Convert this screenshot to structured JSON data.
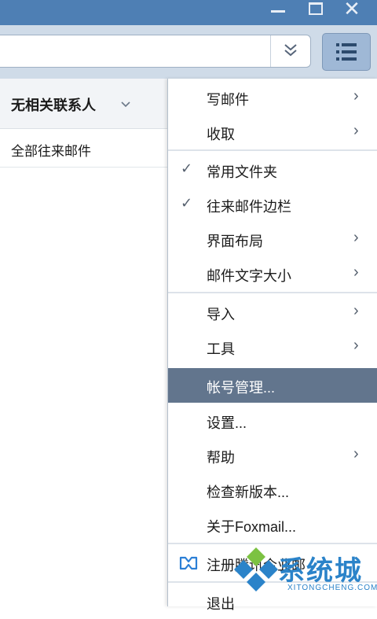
{
  "window": {
    "minimize_icon": "minimize-icon",
    "maximize_icon": "maximize-icon",
    "close_glyph": "✕"
  },
  "toolbar": {
    "search_dropdown_glyph": "»",
    "menu_icon": "hamburger-list-icon"
  },
  "left_pane": {
    "header_title": "无相关联系人",
    "header_chevron": "⌵",
    "row_label": "全部往来邮件"
  },
  "menu": {
    "items": [
      {
        "label": "写邮件",
        "submenu": true
      },
      {
        "label": "收取",
        "submenu": true
      },
      {
        "label": "常用文件夹",
        "checked": true
      },
      {
        "label": "往来邮件边栏",
        "checked": true
      },
      {
        "label": "界面布局",
        "submenu": true
      },
      {
        "label": "邮件文字大小",
        "submenu": true
      },
      {
        "label": "导入",
        "submenu": true
      },
      {
        "label": "工具",
        "submenu": true
      },
      {
        "label": "帐号管理...",
        "highlighted": true
      },
      {
        "label": "设置..."
      },
      {
        "label": "帮助",
        "submenu": true
      },
      {
        "label": "检查新版本..."
      },
      {
        "label": "关于Foxmail..."
      },
      {
        "label": "注册腾讯企业邮",
        "icon": "link-icon"
      },
      {
        "label": "退出"
      }
    ],
    "arrow_glyph": "›",
    "check_glyph": "✓"
  },
  "watermark": {
    "brand": "系统城",
    "url": "XITONGCHENG.COM"
  },
  "colors": {
    "titlebar": "#4e7fb4",
    "toolbar": "#cfdbe8",
    "menu_highlight": "#62758d",
    "watermark": "#2b83c9"
  }
}
